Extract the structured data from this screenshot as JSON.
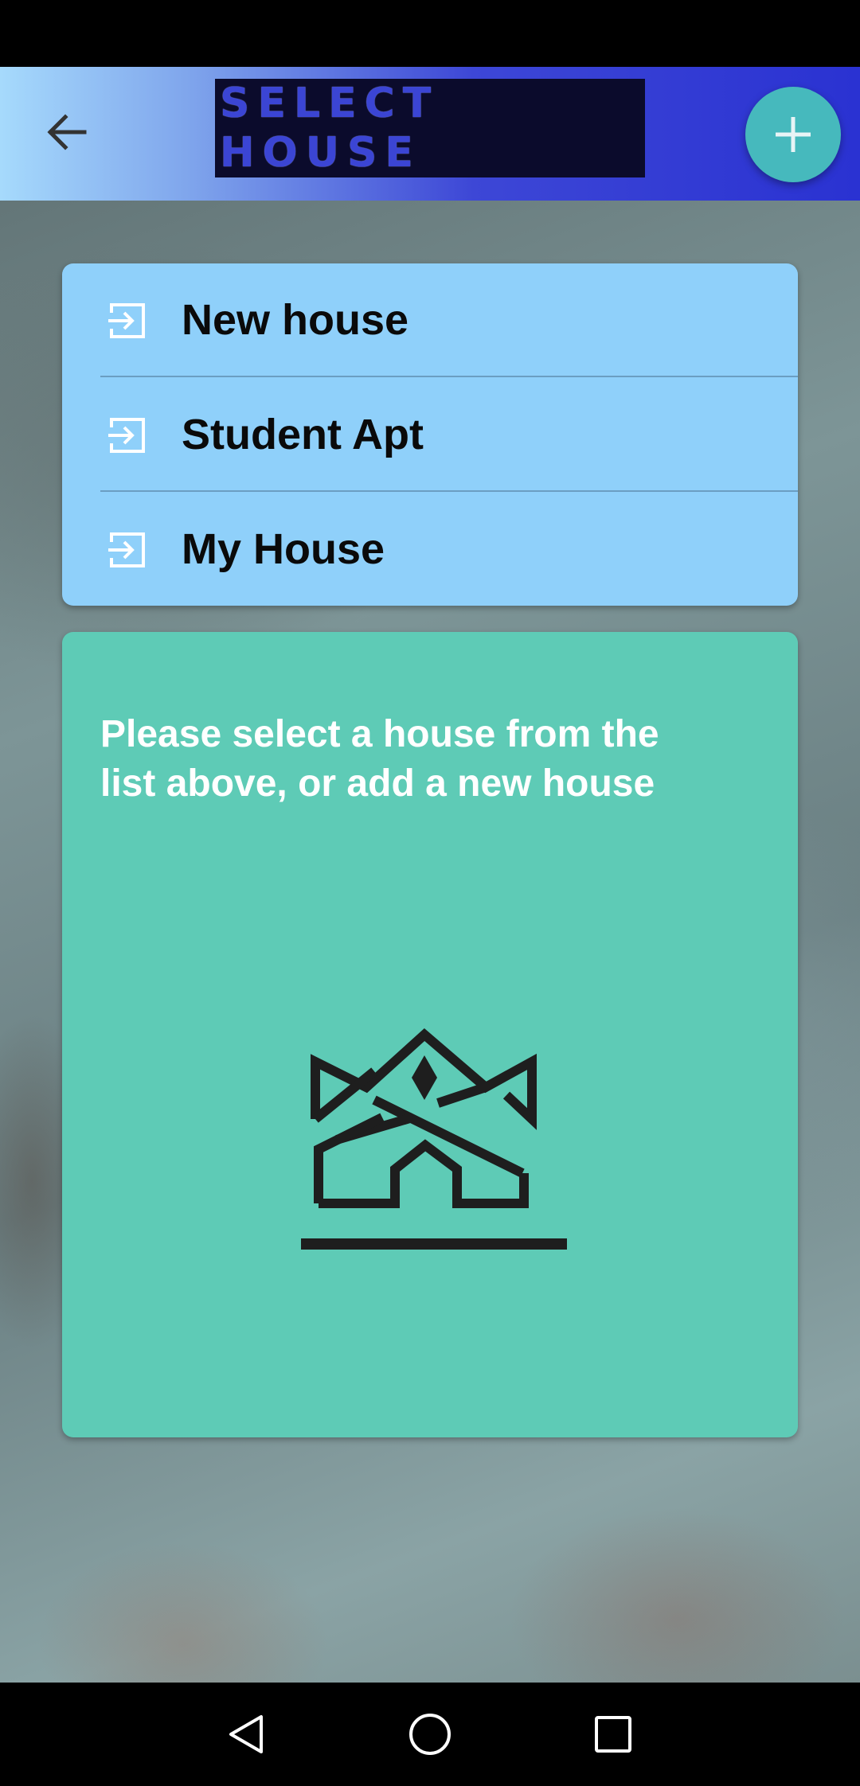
{
  "app_bar": {
    "title": "SELECT HOUSE",
    "back_icon": "arrow-left-icon",
    "add_icon": "plus-icon"
  },
  "houses": [
    {
      "label": "New house",
      "icon": "enter-icon"
    },
    {
      "label": "Student Apt",
      "icon": "enter-icon"
    },
    {
      "label": "My House",
      "icon": "enter-icon"
    }
  ],
  "info": {
    "line1": "Please select a house from the",
    "line2": "list above, or add a new house"
  },
  "nav": {
    "back_icon": "triangle-back-icon",
    "home_icon": "circle-home-icon",
    "recents_icon": "square-recents-icon"
  },
  "colors": {
    "app_bar_start": "#a6dafc",
    "app_bar_end": "#2a32d2",
    "fab": "#46b9bd",
    "list_card": "#8fd0fa",
    "info_card": "#5ecbb6"
  }
}
